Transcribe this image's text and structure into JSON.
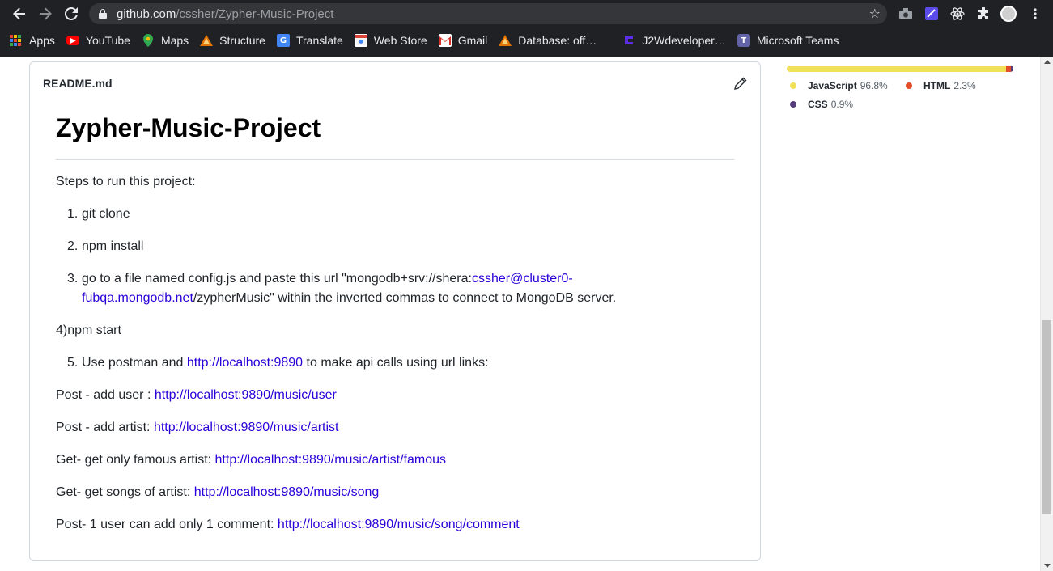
{
  "browser": {
    "url_host": "github.com",
    "url_path": "/cssher/Zypher-Music-Project",
    "back_icon": "back-arrow-icon",
    "forward_icon": "forward-arrow-icon",
    "reload_icon": "reload-icon",
    "bookmarks": [
      {
        "label": "Apps",
        "icon": "apps-grid-icon",
        "color": "#ea4335"
      },
      {
        "label": "YouTube",
        "icon": "youtube-icon",
        "color": "#ff0000"
      },
      {
        "label": "Maps",
        "icon": "maps-pin-icon",
        "color": "#34a853"
      },
      {
        "label": "Structure",
        "icon": "structure-icon",
        "color": "#e37400"
      },
      {
        "label": "Translate",
        "icon": "translate-icon",
        "color": "#4285f4"
      },
      {
        "label": "Web Store",
        "icon": "web-store-icon",
        "color": "#db4437"
      },
      {
        "label": "Gmail",
        "icon": "gmail-icon",
        "color": "#d93025"
      },
      {
        "label": "Database: off…",
        "icon": "database-icon",
        "color": "#e37400"
      },
      {
        "label": "J2Wdeveloper…",
        "icon": "j2w-icon",
        "color": "#5b2ee6"
      },
      {
        "label": "Microsoft Teams",
        "icon": "teams-icon",
        "color": "#6264a7"
      }
    ]
  },
  "readme": {
    "filename": "README.md",
    "title": "Zypher-Music-Project",
    "steps_intro": "Steps to run this project:",
    "item1": "git clone",
    "item2": "npm install",
    "item3_pre": "go to a file named config.js and paste this url \"mongodb+srv://shera:",
    "item3_link1": "cssher@cluster0-",
    "item3_link2": "fubqa.mongodb.net",
    "item3_post": "/zypherMusic\" within the inverted commas to connect to MongoDB server.",
    "step4": "4)npm start",
    "item5_pre": "Use postman and ",
    "item5_link": "http://localhost:9890",
    "item5_post": " to make api calls using url links:",
    "post_user_label": "Post - add user : ",
    "post_user_link": "http://localhost:9890/music/user",
    "post_artist_label": "Post - add artist: ",
    "post_artist_link": "http://localhost:9890/music/artist",
    "get_famous_label": "Get- get only famous artist: ",
    "get_famous_link": "http://localhost:9890/music/artist/famous",
    "get_songs_label": "Get- get songs of artist: ",
    "get_songs_link": "http://localhost:9890/music/song",
    "post_comment_label": "Post- 1 user can add only 1 comment: ",
    "post_comment_link": "http://localhost:9890/music/song/comment"
  },
  "languages": [
    {
      "name": "JavaScript",
      "percent": "96.8%",
      "value": 96.8,
      "color": "#f1e05a"
    },
    {
      "name": "HTML",
      "percent": "2.3%",
      "value": 2.3,
      "color": "#e34c26"
    },
    {
      "name": "CSS",
      "percent": "0.9%",
      "value": 0.9,
      "color": "#563d7c"
    }
  ],
  "colors": {
    "link": "#2a00d8",
    "chrome_bg": "#202124"
  }
}
